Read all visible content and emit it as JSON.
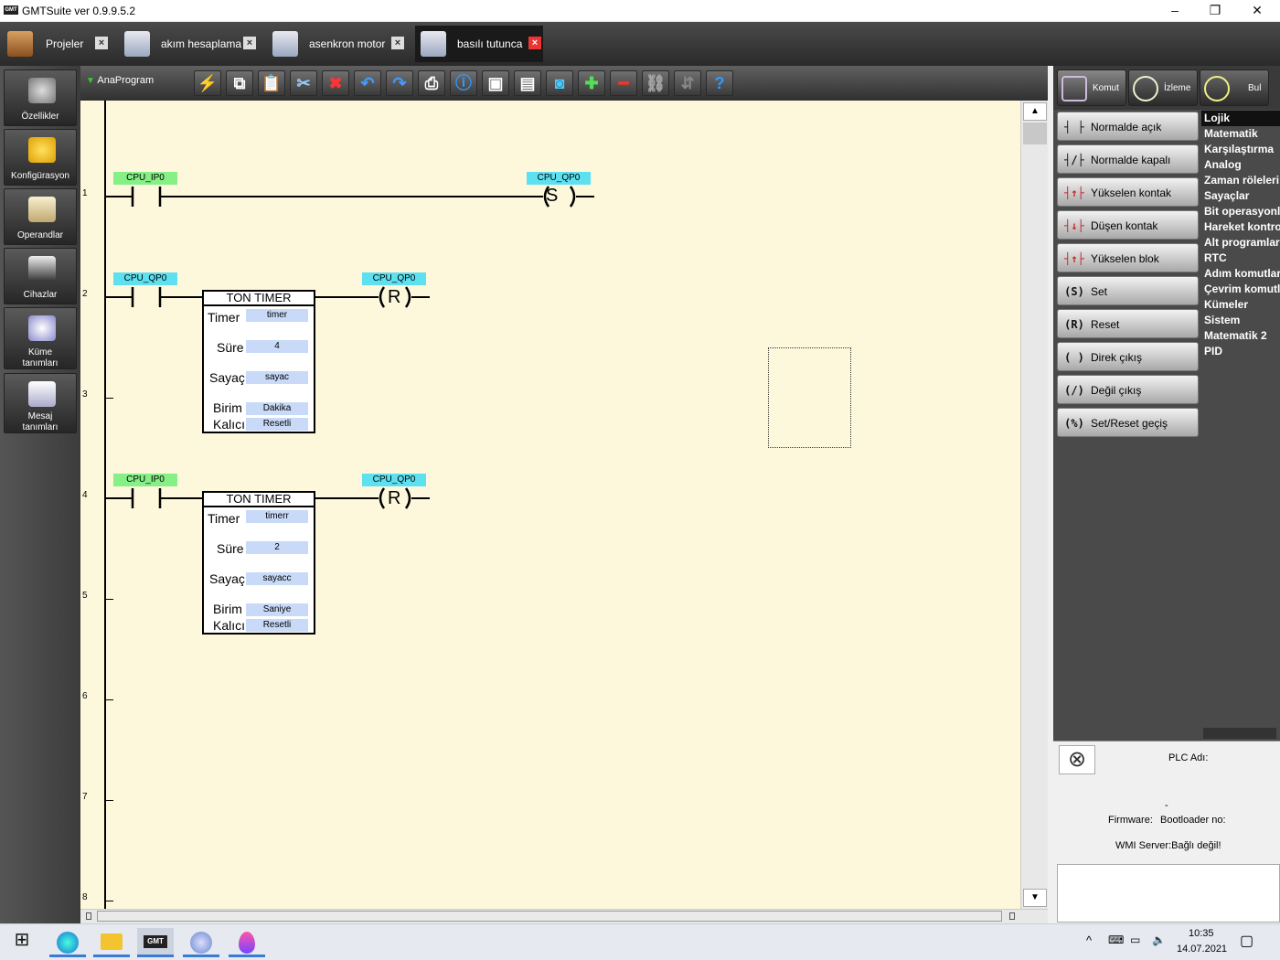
{
  "window": {
    "title": "GMTSuite ver 0.9.9.5.2",
    "logo": "GMT"
  },
  "tabs": [
    {
      "label": "Projeler"
    },
    {
      "label": "akım hesaplama"
    },
    {
      "label": "asenkron motor"
    },
    {
      "label": "basılı tutunca"
    }
  ],
  "sidebar": {
    "items": [
      {
        "label1": "Özellikler",
        "label2": ""
      },
      {
        "label1": "Konfigürasyon",
        "label2": ""
      },
      {
        "label1": "Operandlar",
        "label2": ""
      },
      {
        "label1": "Cihazlar",
        "label2": ""
      },
      {
        "label1": "Küme",
        "label2": "tanımları"
      },
      {
        "label1": "Mesaj",
        "label2": "tanımları"
      }
    ]
  },
  "toolbar": {
    "program": "AnaProgram"
  },
  "ladder": {
    "row_numbers": [
      "1",
      "2",
      "3",
      "4",
      "5",
      "6",
      "7",
      "8"
    ],
    "rung1": {
      "contact": "CPU_IP0",
      "coil": "CPU_QP0",
      "coil_symbol": "S"
    },
    "rung2": {
      "contact": "CPU_QP0",
      "coil": "CPU_QP0",
      "coil_symbol": "R",
      "timer": {
        "title": "TON TIMER",
        "labels": [
          "Timer",
          "Süre",
          "Sayaç",
          "Birim",
          "Kalıcı"
        ],
        "values": [
          "timer",
          "4",
          "sayac",
          "Dakika",
          "Resetli"
        ]
      }
    },
    "rung3": {
      "contact": "CPU_IP0",
      "coil": "CPU_QP0",
      "coil_symbol": "R",
      "timer": {
        "title": "TON TIMER",
        "labels": [
          "Timer",
          "Süre",
          "Sayaç",
          "Birim",
          "Kalıcı"
        ],
        "values": [
          "timerr",
          "2",
          "sayacc",
          "Saniye",
          "Resetli"
        ]
      }
    }
  },
  "right_tabs": [
    {
      "label": "Komut"
    },
    {
      "label": "İzleme"
    },
    {
      "label": "Bul"
    }
  ],
  "commands": [
    {
      "glyph": "┤ ├",
      "label": "Normalde açık"
    },
    {
      "glyph": "┤/├",
      "label": "Normalde kapalı"
    },
    {
      "glyph": "┤↑├",
      "label": "Yükselen kontak"
    },
    {
      "glyph": "┤↓├",
      "label": "Düşen kontak"
    },
    {
      "glyph": "┤↑├",
      "label": "Yükselen blok"
    },
    {
      "glyph": "(S)",
      "label": "Set"
    },
    {
      "glyph": "(R)",
      "label": "Reset"
    },
    {
      "glyph": "( )",
      "label": "Direk çıkış"
    },
    {
      "glyph": "(/)",
      "label": "Değil çıkış"
    },
    {
      "glyph": "(%)",
      "label": "Set/Reset geçiş"
    }
  ],
  "categories": [
    "Lojik",
    "Matematik",
    "Karşılaştırma",
    "Analog",
    "Zaman röleleri",
    "Sayaçlar",
    "Bit operasyonları",
    "Hareket kontrol",
    "Alt programlar",
    "RTC",
    "Adım komutları",
    "Çevrim komutları",
    "Kümeler",
    "Sistem",
    "Matematik 2",
    "PID"
  ],
  "plc": {
    "name_label": "PLC Adı:",
    "dash": "-",
    "firmware": "Firmware:",
    "bootloader": "Bootloader no:",
    "wmi": "WMI Server:Bağlı değil!"
  },
  "taskbar": {
    "time": "10:35",
    "date": "14.07.2021"
  }
}
